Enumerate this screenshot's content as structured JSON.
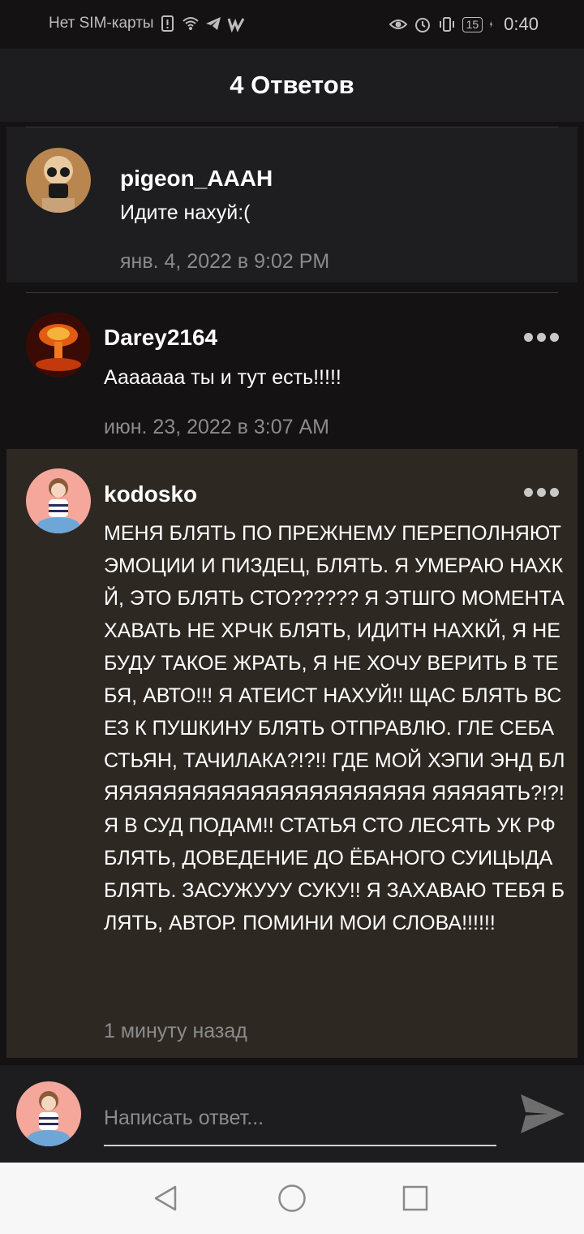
{
  "status_bar": {
    "carrier": "Нет SIM-карты",
    "battery": "15",
    "time": "0:40"
  },
  "header": {
    "title": "4 Ответов"
  },
  "comments": [
    {
      "username": "pigeon_AAAH",
      "text": "Идите нахуй:(",
      "time": "янв. 4, 2022 в 9:02 PM",
      "highlight_color": "#1e1d1f"
    },
    {
      "username": "Darey2164",
      "text": "Ааааааа ты и тут есть!!!!!",
      "time": "июн. 23, 2022 в 3:07 AM"
    },
    {
      "username": "kodosko",
      "text": "МЕНЯ БЛЯТЬ ПО ПРЕЖНЕМУ ПЕРЕПОЛНЯЮТ ЭМОЦИИ И ПИЗДЕЦ, БЛЯТЬ. Я УМЕРАЮ НАХКЙ, ЭТО БЛЯТЬ СТО?????? Я ЭТШГО МОМЕНТА ХАВАТЬ НЕ ХРЧК БЛЯТЬ, ИДИТН НАХКЙ, Я НЕ БУДУ ТАКОЕ ЖРАТЬ, Я НЕ ХОЧУ ВЕРИТЬ В ТЕБЯ, АВТО!!! Я АТЕИСТ НАХУЙ!! ЩАС БЛЯТЬ ВСЕЗ К ПУШКИНУ БЛЯТЬ ОТПРАВЛЮ. ГЛЕ СЕБАСТЬЯН, ТАЧИЛАКА?!?!! ГДЕ МОЙ ХЭПИ ЭНД БЛЯЯЯЯЯЯЯЯЯЯЯЯЯЯЯЯЯЯЯЯЯЯ ЯЯЯЯЯТЬ?!?! Я В СУД ПОДАМ!! СТАТЬЯ СТО ЛЕСЯТЬ УК РФ БЛЯТЬ, ДОВЕДЕНИЕ ДО ЁБАНОГО СУИЦЫДА БЛЯТЬ. ЗАСУЖУУУ СУКУ!! Я ЗАХАВАЮ ТЕБЯ БЛЯТЬ, АВТОР. ПОМИНИ МОИ СЛОВА!!!!!!",
      "time": "1 минуту назад",
      "highlight_color": "#2e2823"
    }
  ],
  "composer": {
    "placeholder": "Написать ответ..."
  }
}
